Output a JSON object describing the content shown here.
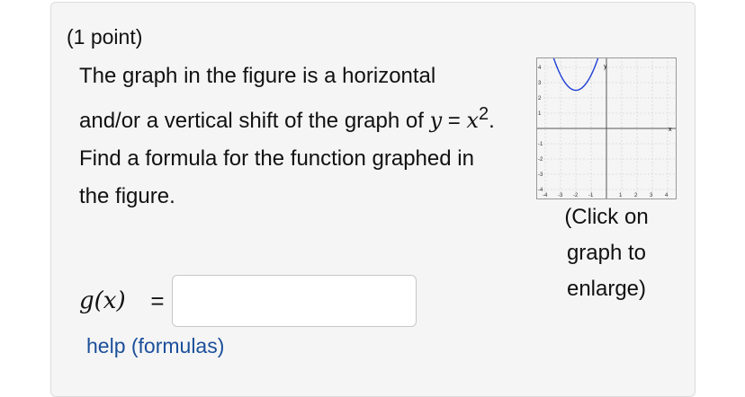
{
  "problem": {
    "points": "(1 point)",
    "text_part1": "The graph in the figure is a horizontal and/or a vertical shift of the graph of ",
    "equation_lhs": "y",
    "equation_op": " = ",
    "equation_base": "x",
    "equation_exp": "2",
    "text_part2": ". Find a formula for the function graphed in the figure."
  },
  "graph": {
    "x_axis_label": "x",
    "y_axis_label": "y",
    "x_ticks": [
      "-4",
      "-3",
      "-2",
      "-1",
      "1",
      "2",
      "3",
      "4"
    ],
    "y_ticks": [
      "4",
      "3",
      "2",
      "1",
      "-1",
      "-2",
      "-3",
      "-4"
    ],
    "curve_color": "#1f3fd6",
    "enlarge_text": "(Click on graph to enlarge)"
  },
  "answer": {
    "label": "g(x)",
    "equals": "=",
    "value": ""
  },
  "help_link": "help (formulas)"
}
